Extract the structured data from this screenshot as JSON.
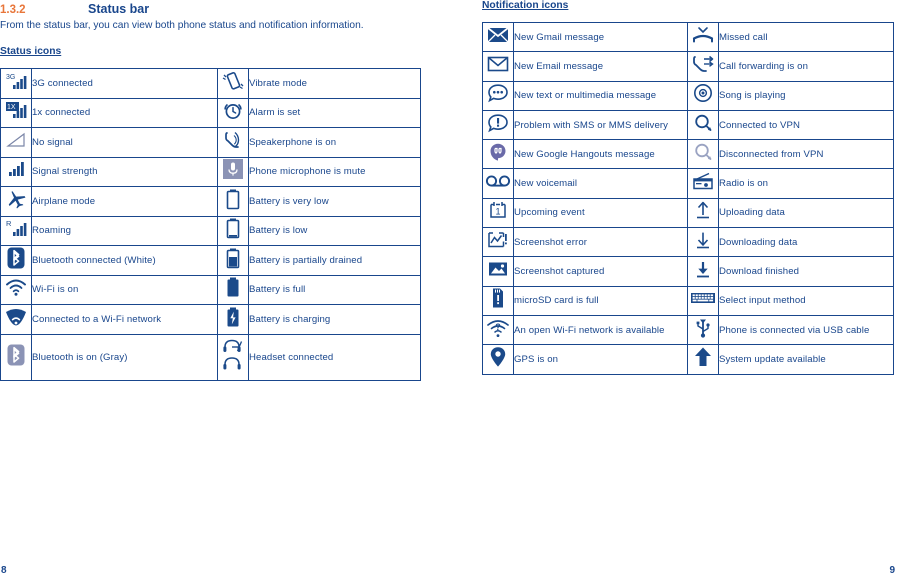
{
  "colors": {
    "brand_blue": "#19468c",
    "accent_orange": "#e8763a",
    "gray_icon": "#8b93b5"
  },
  "left_page": {
    "section_number": "1.3.2",
    "section_title": "Status bar",
    "intro": "From the status bar, you can view both phone status and notification information.",
    "subheading": "Status icons",
    "page_number": "8",
    "rows": [
      {
        "left_icon": "3g-connected-icon",
        "left_label": "3G connected",
        "right_icon": "vibrate-mode-icon",
        "right_label": "Vibrate mode"
      },
      {
        "left_icon": "1x-connected-icon",
        "left_label": "1x connected",
        "right_icon": "alarm-clock-icon",
        "right_label": "Alarm is set"
      },
      {
        "left_icon": "no-signal-icon",
        "left_label": "No signal",
        "right_icon": "speakerphone-icon",
        "right_label": "Speakerphone is on"
      },
      {
        "left_icon": "signal-strength-icon",
        "left_label": "Signal strength",
        "right_icon": "microphone-mute-icon",
        "right_label": "Phone microphone is mute"
      },
      {
        "left_icon": "airplane-mode-icon",
        "left_label": "Airplane mode",
        "right_icon": "battery-very-low-icon",
        "right_label": "Battery is very low"
      },
      {
        "left_icon": "roaming-icon",
        "left_label": "Roaming",
        "right_icon": "battery-low-icon",
        "right_label": "Battery is low"
      },
      {
        "left_icon": "bluetooth-connected-icon",
        "left_label": "Bluetooth connected (White)",
        "right_icon": "battery-partial-icon",
        "right_label": "Battery is partially drained"
      },
      {
        "left_icon": "wifi-on-icon",
        "left_label": "Wi-Fi is on",
        "right_icon": "battery-full-icon",
        "right_label": "Battery is full"
      },
      {
        "left_icon": "wifi-connected-icon",
        "left_label": "Connected to a Wi-Fi network",
        "right_icon": "battery-charging-icon",
        "right_label": "Battery is charging"
      },
      {
        "left_icon": "bluetooth-on-gray-icon",
        "left_label": "Bluetooth is on (Gray)",
        "right_icon": "headset-connected-icon",
        "right_label": "Headset connected"
      }
    ]
  },
  "right_page": {
    "subheading": "Notification icons",
    "page_number": "9",
    "rows": [
      {
        "left_icon": "gmail-icon",
        "left_label": "New Gmail message",
        "right_icon": "missed-call-icon",
        "right_label": "Missed call"
      },
      {
        "left_icon": "email-icon",
        "left_label": "New Email message",
        "right_icon": "call-forwarding-icon",
        "right_label": "Call forwarding is on"
      },
      {
        "left_icon": "sms-message-icon",
        "left_label": "New text or multimedia message",
        "right_icon": "song-playing-icon",
        "right_label": "Song is playing"
      },
      {
        "left_icon": "sms-problem-icon",
        "left_label": "Problem with SMS or MMS delivery",
        "right_icon": "vpn-connected-icon",
        "right_label": "Connected to VPN"
      },
      {
        "left_icon": "hangouts-icon",
        "left_label": "New Google Hangouts message",
        "right_icon": "vpn-disconnected-icon",
        "right_label": "Disconnected from VPN"
      },
      {
        "left_icon": "voicemail-icon",
        "left_label": "New voicemail",
        "right_icon": "radio-icon",
        "right_label": "Radio is on"
      },
      {
        "left_icon": "calendar-event-icon",
        "left_label": "Upcoming event",
        "right_icon": "upload-icon",
        "right_label": "Uploading data"
      },
      {
        "left_icon": "screenshot-error-icon",
        "left_label": "Screenshot error",
        "right_icon": "download-icon",
        "right_label": "Downloading data"
      },
      {
        "left_icon": "screenshot-captured-icon",
        "left_label": " Screenshot captured",
        "right_icon": "download-finished-icon",
        "right_label": "Download finished"
      },
      {
        "left_icon": "microsd-full-icon",
        "left_label": "microSD card is full",
        "right_icon": "keyboard-icon",
        "right_label": "Select input method"
      },
      {
        "left_icon": "open-wifi-icon",
        "left_label": "An open Wi-Fi network is available",
        "right_icon": "usb-icon",
        "right_label": "Phone is connected via USB cable"
      },
      {
        "left_icon": "gps-icon",
        "left_label": "GPS is on",
        "right_icon": "system-update-icon",
        "right_label": "System update available"
      }
    ]
  }
}
